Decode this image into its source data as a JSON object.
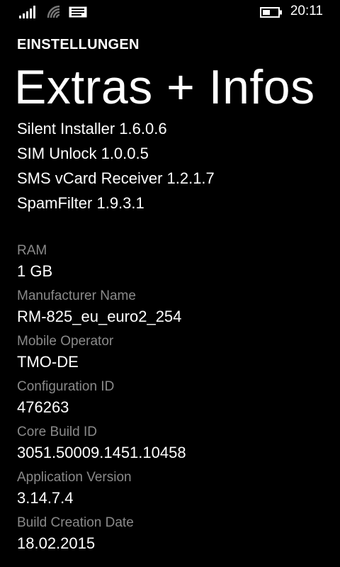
{
  "status_bar": {
    "time": "20:11",
    "icons": [
      "signal-strength-icon",
      "wifi-icon",
      "message-icon",
      "battery-icon"
    ]
  },
  "header": {
    "app_title": "EINSTELLUNGEN",
    "page_title": "Extras + Infos"
  },
  "apps": [
    "Silent Installer 1.6.0.6",
    "SIM Unlock 1.0.0.5",
    "SMS vCard Receiver 1.2.1.7",
    "SpamFilter 1.9.3.1"
  ],
  "info": [
    {
      "label": "RAM",
      "value": "1 GB"
    },
    {
      "label": "Manufacturer Name",
      "value": "RM-825_eu_euro2_254"
    },
    {
      "label": "Mobile Operator",
      "value": "TMO-DE"
    },
    {
      "label": "Configuration ID",
      "value": "476263"
    },
    {
      "label": "Core Build ID",
      "value": "3051.50009.1451.10458"
    },
    {
      "label": "Application Version",
      "value": "3.14.7.4"
    },
    {
      "label": "Build Creation Date",
      "value": "18.02.2015"
    }
  ],
  "colors": {
    "background": "#000000",
    "text": "#ffffff",
    "label": "#8a8a8a"
  }
}
